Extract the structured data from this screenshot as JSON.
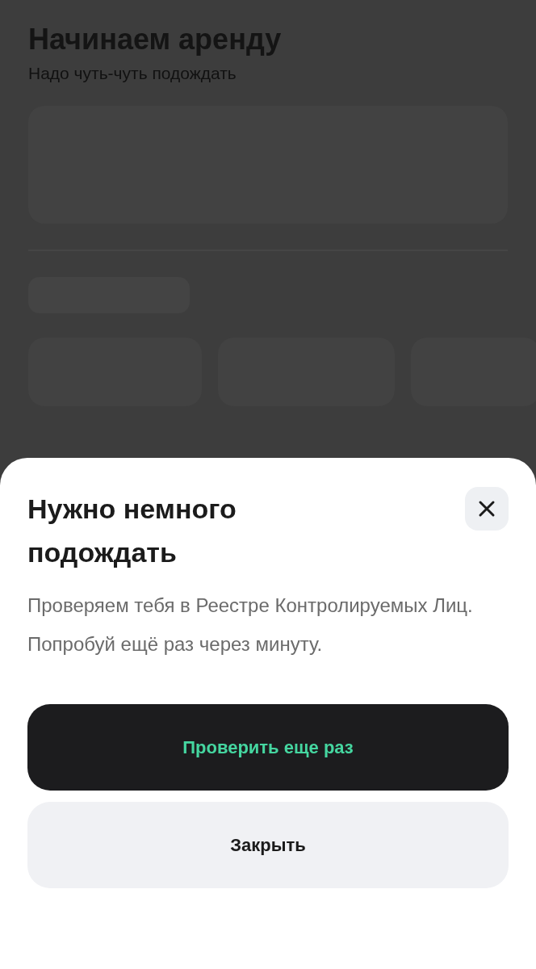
{
  "background_screen": {
    "title": "Начинаем аренду",
    "subtitle": "Надо чуть-чуть подождать"
  },
  "sheet": {
    "title": "Нужно немного подождать",
    "message": "Проверяем тебя в Реестре Контролируемых Лиц. Попробуй ещё раз через минуту.",
    "buttons": [
      {
        "label": "Проверить еще раз",
        "kind": "primary"
      },
      {
        "label": "Закрыть",
        "kind": "secondary"
      }
    ]
  }
}
